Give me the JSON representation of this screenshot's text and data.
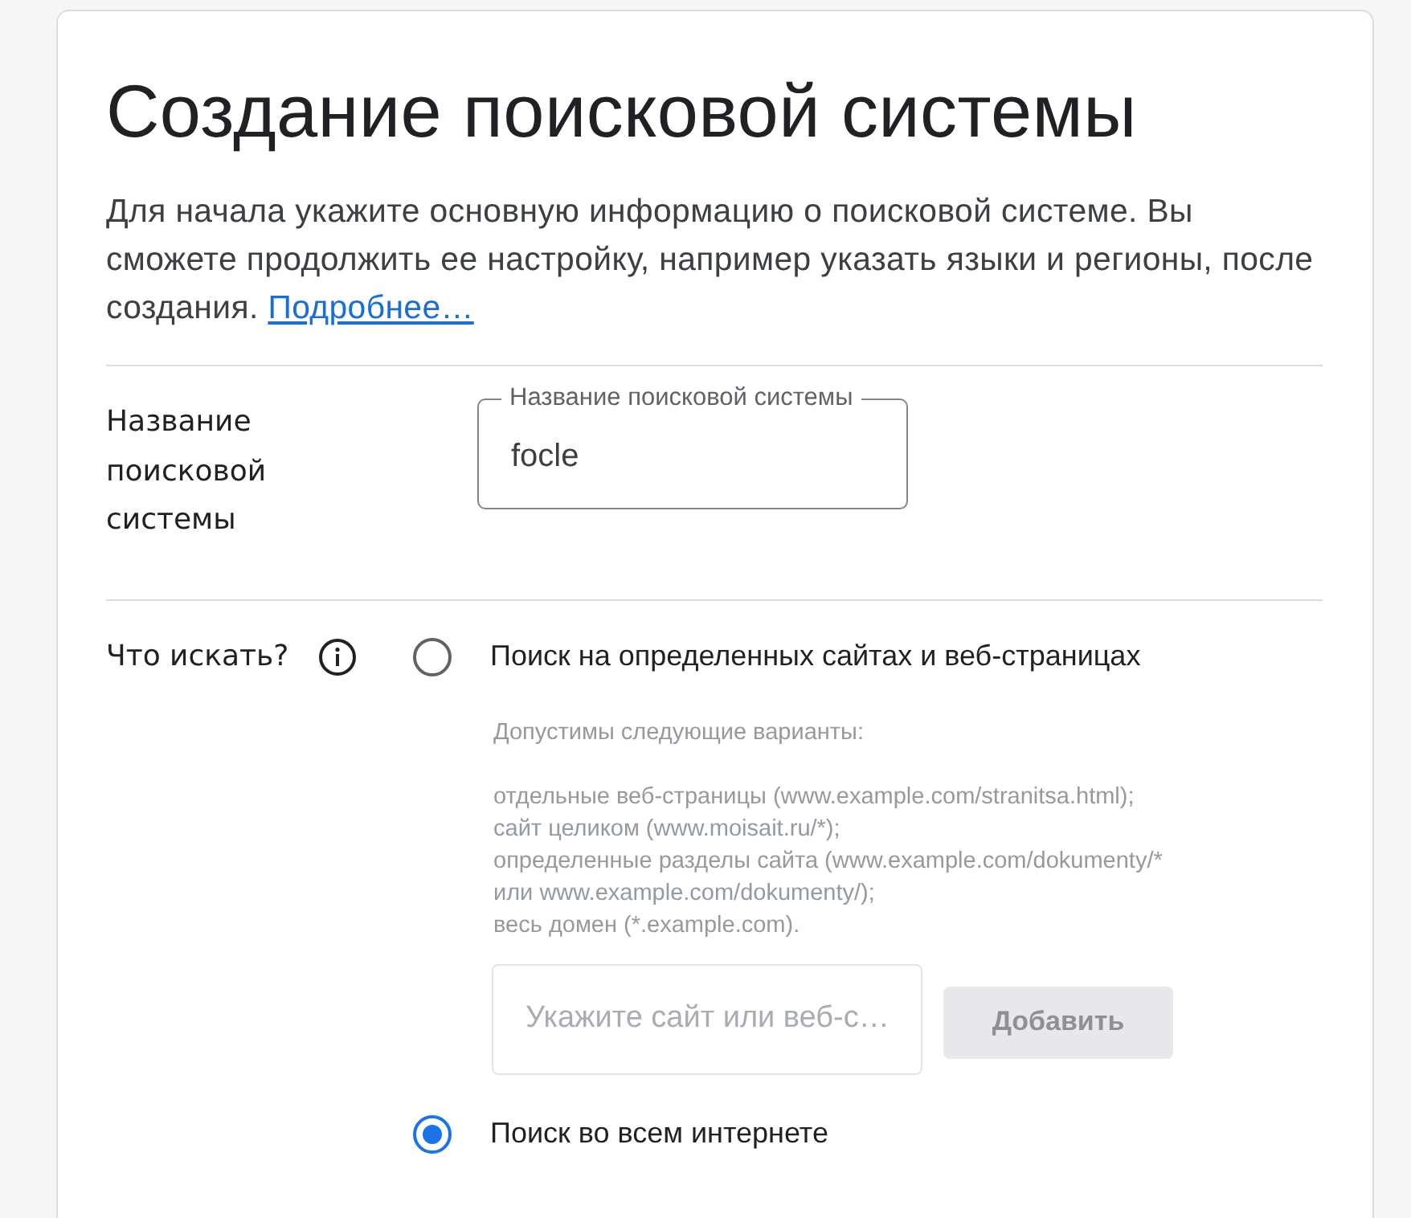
{
  "title": "Создание поисковой системы",
  "intro": {
    "text": "Для начала укажите основную информацию о поисковой системе. Вы сможете продолжить ее настройку, например указать языки и регионы, после создания.",
    "link": "Подробнее…"
  },
  "name_section": {
    "label": "Название поисковой системы",
    "field": {
      "label": "Название поисковой системы",
      "value": "focle"
    }
  },
  "search_section": {
    "label": "Что искать?",
    "options": [
      {
        "label": "Поиск на определенных сайтах и веб-страницах",
        "selected": false,
        "hint_heading": "Допустимы следующие варианты:",
        "hint_items": [
          "отдельные веб-страницы (www.example.com/stranitsa.html);",
          "сайт целиком (www.moisait.ru/*);",
          "определенные разделы сайта (www.example.com/dokumenty/* или www.example.com/dokumenty/);",
          "весь домен (*.example.com)."
        ],
        "site_field": {
          "placeholder": "Укажите сайт или веб-с…"
        },
        "add_button": {
          "label": "Добавить"
        }
      },
      {
        "label": "Поиск во всем интернете",
        "selected": true
      }
    ]
  }
}
